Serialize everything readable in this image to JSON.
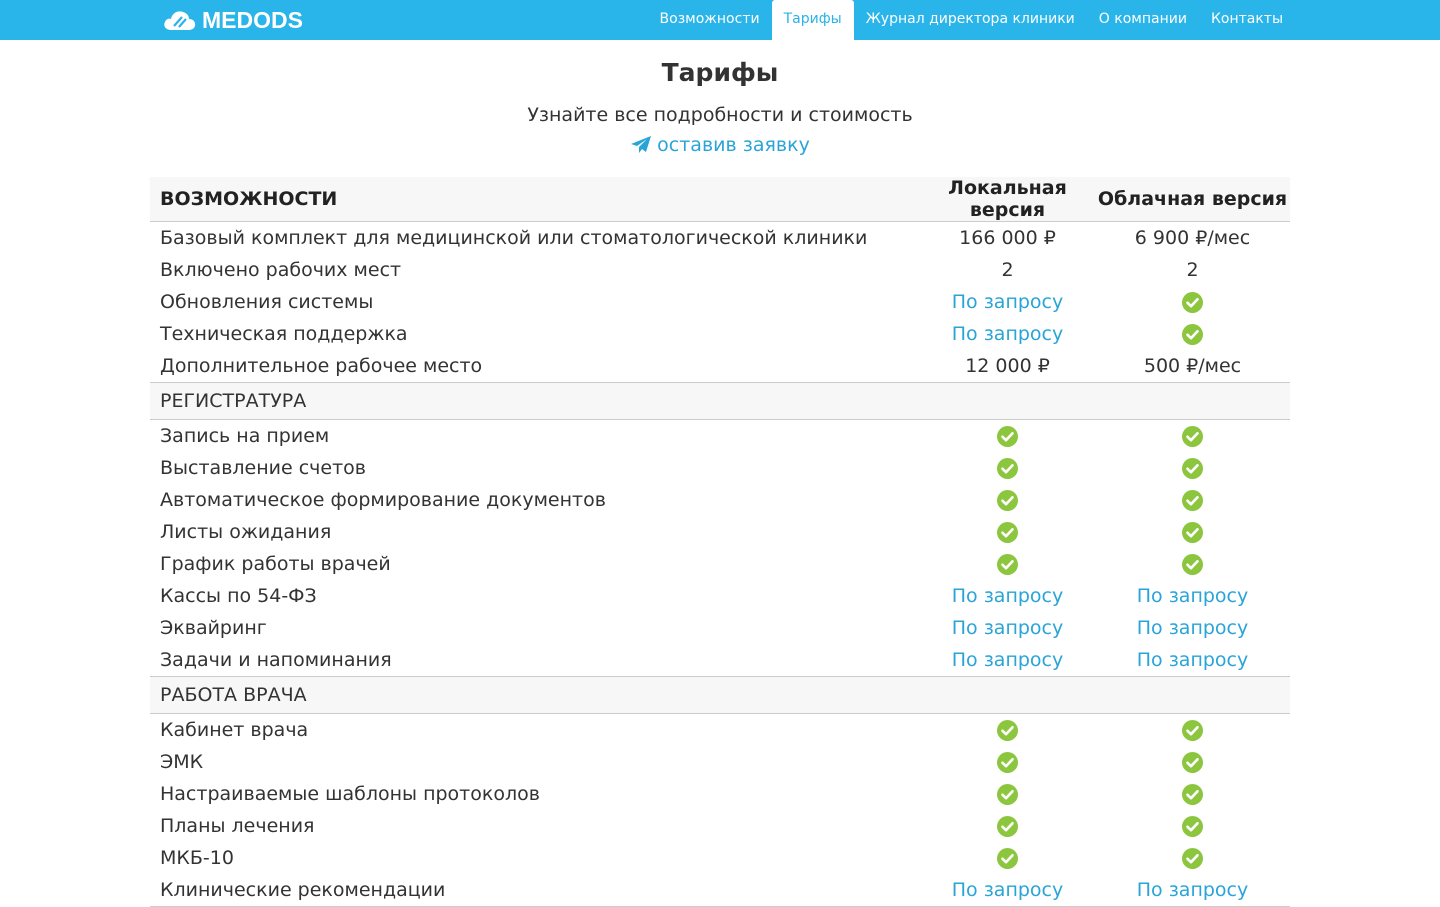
{
  "brand": {
    "name": "MEDODS"
  },
  "nav": [
    {
      "label": "Возможности",
      "active": false
    },
    {
      "label": "Тарифы",
      "active": true
    },
    {
      "label": "Журнал директора клиники",
      "active": false
    },
    {
      "label": "О компании",
      "active": false
    },
    {
      "label": "Контакты",
      "active": false
    }
  ],
  "page": {
    "title": "Тарифы",
    "subtitle": "Узнайте все подробности и стоимость",
    "apply_link": "оставив заявку"
  },
  "table": {
    "headers": [
      "ВОЗМОЖНОСТИ",
      "Локальная версия",
      "Облачная версия"
    ],
    "groups": [
      {
        "title": null,
        "rows": [
          {
            "feature": "Базовый комплект для медицинской или стоматологической клиники",
            "local": "166 000 ₽",
            "cloud": "6 900 ₽/мес"
          },
          {
            "feature": "Включено рабочих мест",
            "local": "2",
            "cloud": "2"
          },
          {
            "feature": "Обновления системы",
            "local": "По запросу",
            "cloud": "check"
          },
          {
            "feature": "Техническая поддержка",
            "local": "По запросу",
            "cloud": "check"
          },
          {
            "feature": "Дополнительное рабочее место",
            "local": "12 000 ₽",
            "cloud": "500 ₽/мес"
          }
        ]
      },
      {
        "title": "РЕГИСТРАТУРА",
        "rows": [
          {
            "feature": "Запись на прием",
            "local": "check",
            "cloud": "check"
          },
          {
            "feature": "Выставление счетов",
            "local": "check",
            "cloud": "check"
          },
          {
            "feature": "Автоматическое формирование документов",
            "local": "check",
            "cloud": "check"
          },
          {
            "feature": "Листы ожидания",
            "local": "check",
            "cloud": "check"
          },
          {
            "feature": "График работы врачей",
            "local": "check",
            "cloud": "check"
          },
          {
            "feature": "Кассы по 54-ФЗ",
            "local": "По запросу",
            "cloud": "По запросу"
          },
          {
            "feature": "Эквайринг",
            "local": "По запросу",
            "cloud": "По запросу"
          },
          {
            "feature": "Задачи и напоминания",
            "local": "По запросу",
            "cloud": "По запросу"
          }
        ]
      },
      {
        "title": "РАБОТА ВРАЧА",
        "rows": [
          {
            "feature": "Кабинет врача",
            "local": "check",
            "cloud": "check"
          },
          {
            "feature": "ЭМК",
            "local": "check",
            "cloud": "check"
          },
          {
            "feature": "Настраиваемые шаблоны протоколов",
            "local": "check",
            "cloud": "check"
          },
          {
            "feature": "Планы лечения",
            "local": "check",
            "cloud": "check"
          },
          {
            "feature": "МКБ-10",
            "local": "check",
            "cloud": "check"
          },
          {
            "feature": "Клинические рекомендации",
            "local": "По запросу",
            "cloud": "По запросу"
          }
        ]
      }
    ]
  },
  "colors": {
    "brand": "#29b4ea",
    "link": "#29a4d8",
    "check": "#8cc63f"
  },
  "icons": {
    "logo": "cloud-logo-icon",
    "apply": "paper-plane-icon",
    "included": "check-circle-icon"
  }
}
